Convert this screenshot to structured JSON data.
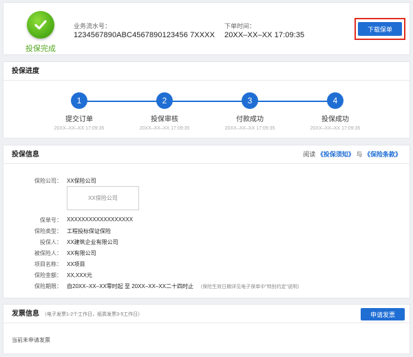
{
  "top": {
    "status_text": "投保完成",
    "serial_label": "业务流水号：",
    "serial_value": "1234567890ABC4567890123456 7XXXX",
    "order_time_label": "下单时间：",
    "order_time_value": "20XX–XX–XX 17:09:35",
    "download_button": "下载保单",
    "highlight_color": "#e02b1c"
  },
  "progress": {
    "title": "投保进度",
    "steps": [
      {
        "num": "1",
        "label": "提交订单",
        "time": "20XX–XX–XX 17:09:35"
      },
      {
        "num": "2",
        "label": "投保审核",
        "time": "20XX–XX–XX 17:09:35"
      },
      {
        "num": "3",
        "label": "付款成功",
        "time": "20XX–XX–XX 17:09:35"
      },
      {
        "num": "4",
        "label": "投保成功",
        "time": "20XX–XX–XX 17:09:35"
      }
    ]
  },
  "info": {
    "title": "投保信息",
    "read_prefix": "阅读",
    "notice_link": "《投保须知》",
    "and_text": "与",
    "terms_link": "《保险条款》",
    "company_label": "保险公司：",
    "company_value": "XX保险公司",
    "logo_text": "XX保险公司",
    "rows": [
      {
        "label": "保单号：",
        "value": "XXXXXXXXXXXXXXXXXX"
      },
      {
        "label": "保险类型：",
        "value": "工程投标保证保险"
      },
      {
        "label": "投保人：",
        "value": "XX建筑企业有限公司"
      },
      {
        "label": "被保险人：",
        "value": "XX有限公司"
      },
      {
        "label": "项目名称：",
        "value": "XX项目"
      },
      {
        "label": "保险金额：",
        "value": "XX,XXX元"
      }
    ],
    "period_label": "保险期限：",
    "period_value": "自20XX–XX–XX零时起 至 20XX–XX–XX二十四时止",
    "period_note": "（保险生效日期详见电子保单中\"特别约定\"说明）"
  },
  "invoice": {
    "title": "发票信息",
    "hint": "（电子发票1-2个工作日，纸质发票3-5工作日）",
    "apply_button": "申请发票",
    "status": "当前未申请发票"
  },
  "colors": {
    "primary": "#1f6ed4",
    "success": "#52a820"
  }
}
